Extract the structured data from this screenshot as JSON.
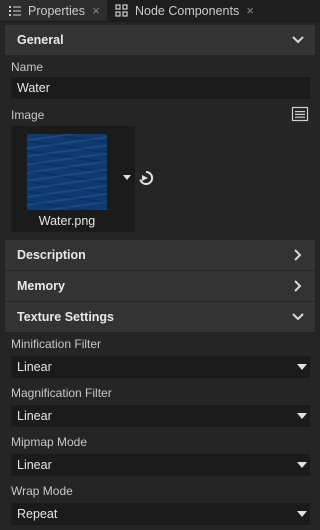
{
  "tabs": [
    {
      "label": "Properties",
      "active": true,
      "icon": "list-icon",
      "closable": true
    },
    {
      "label": "Node Components",
      "active": false,
      "icon": "components-icon",
      "closable": true
    }
  ],
  "sections": {
    "general": {
      "title": "General",
      "expanded": true
    },
    "description": {
      "title": "Description",
      "expanded": false
    },
    "memory": {
      "title": "Memory",
      "expanded": false
    },
    "texture_settings": {
      "title": "Texture Settings",
      "expanded": true
    }
  },
  "general": {
    "name_label": "Name",
    "name_value": "Water",
    "image_label": "Image",
    "image_file": "Water.png"
  },
  "texture_settings": {
    "minification_label": "Minification Filter",
    "minification_value": "Linear",
    "magnification_label": "Magnification Filter",
    "magnification_value": "Linear",
    "mipmap_label": "Mipmap Mode",
    "mipmap_value": "Linear",
    "wrap_label": "Wrap Mode",
    "wrap_value": "Repeat"
  },
  "colors": {
    "background": "#252526",
    "section_header": "#333333",
    "input_bg": "#1b1b1b",
    "texture_blue": "#0e3a72"
  }
}
